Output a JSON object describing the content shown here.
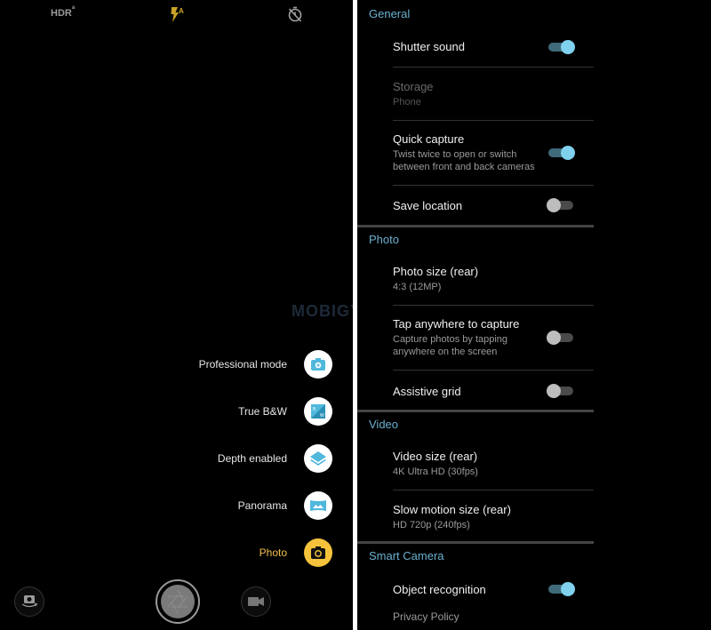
{
  "camera": {
    "top_bar": {
      "hdr_label": "HDR",
      "hdr_badge": "a",
      "flash_mode": "A",
      "flash_color": "#c9a227",
      "timer_state": "off"
    },
    "watermark": "MOBIGYAAN",
    "modes": [
      {
        "label": "Professional mode",
        "icon": "camera-plus-icon",
        "active": false
      },
      {
        "label": "True B&W",
        "icon": "bw-filter-icon",
        "active": false
      },
      {
        "label": "Depth enabled",
        "icon": "layers-icon",
        "active": false
      },
      {
        "label": "Panorama",
        "icon": "panorama-icon",
        "active": false
      },
      {
        "label": "Photo",
        "icon": "camera-icon",
        "active": true
      }
    ],
    "accent_color": "#f5c33b",
    "mode_icon_color": "#4fb8dc"
  },
  "settings": {
    "accent_color": "#6ab0cf",
    "sections": [
      {
        "title": "General",
        "items": [
          {
            "title": "Shutter sound",
            "subtitle": "",
            "toggle": true
          },
          {
            "title": "Storage",
            "subtitle": "Phone",
            "disabled": true
          },
          {
            "title": "Quick capture",
            "subtitle": "Twist twice to open or switch between front and back cameras",
            "toggle": true
          },
          {
            "title": "Save location",
            "subtitle": "",
            "toggle": false
          }
        ]
      },
      {
        "title": "Photo",
        "items": [
          {
            "title": "Photo size (rear)",
            "subtitle": "4:3 (12MP)"
          },
          {
            "title": "Tap anywhere to capture",
            "subtitle": "Capture photos by tapping anywhere on the screen",
            "toggle": false
          },
          {
            "title": "Assistive grid",
            "subtitle": "",
            "toggle": false
          }
        ]
      },
      {
        "title": "Video",
        "items": [
          {
            "title": "Video size (rear)",
            "subtitle": "4K Ultra HD (30fps)"
          },
          {
            "title": "Slow motion size (rear)",
            "subtitle": "HD 720p (240fps)"
          }
        ]
      },
      {
        "title": "Smart Camera",
        "items": [
          {
            "title": "Object recognition",
            "subtitle": "",
            "toggle": true
          },
          {
            "title": "Privacy Policy",
            "subtitle": ""
          }
        ]
      }
    ]
  }
}
